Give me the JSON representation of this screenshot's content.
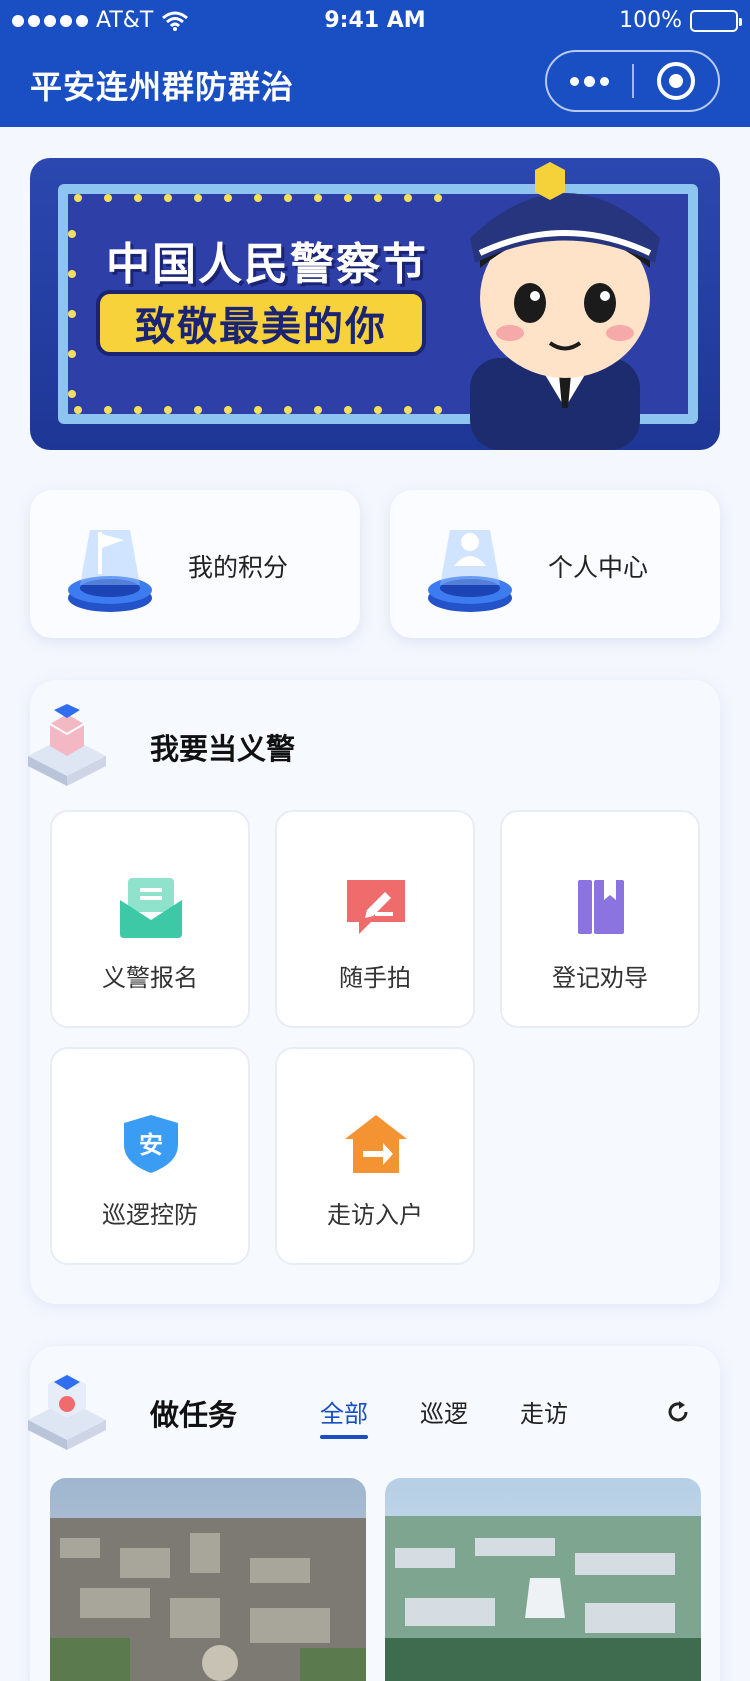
{
  "status_bar": {
    "carrier": "AT&T",
    "time": "9:41 AM",
    "battery": "100%"
  },
  "app": {
    "title": "平安连州群防群治"
  },
  "banner": {
    "line1": "中国人民警察节",
    "line2": "致敬最美的你"
  },
  "quick_links": [
    {
      "label": "我的积分",
      "icon": "flag-icon"
    },
    {
      "label": "个人中心",
      "icon": "user-icon"
    }
  ],
  "volunteer_section": {
    "title": "我要当义警",
    "items": [
      {
        "label": "义警报名",
        "icon": "mail-icon",
        "color": "#3dc9a6"
      },
      {
        "label": "随手拍",
        "icon": "edit-icon",
        "color": "#f06b6b"
      },
      {
        "label": "登记劝导",
        "icon": "book-icon",
        "color": "#8c74e0"
      },
      {
        "label": "巡逻控防",
        "icon": "shield-icon",
        "color": "#3b9cf3"
      },
      {
        "label": "走访入户",
        "icon": "house-arrow-icon",
        "color": "#f49332"
      }
    ]
  },
  "task_section": {
    "title": "做任务",
    "tabs": [
      "全部",
      "巡逻",
      "走访"
    ],
    "active_tab": "全部"
  },
  "colors": {
    "primary": "#1a4fc4"
  }
}
